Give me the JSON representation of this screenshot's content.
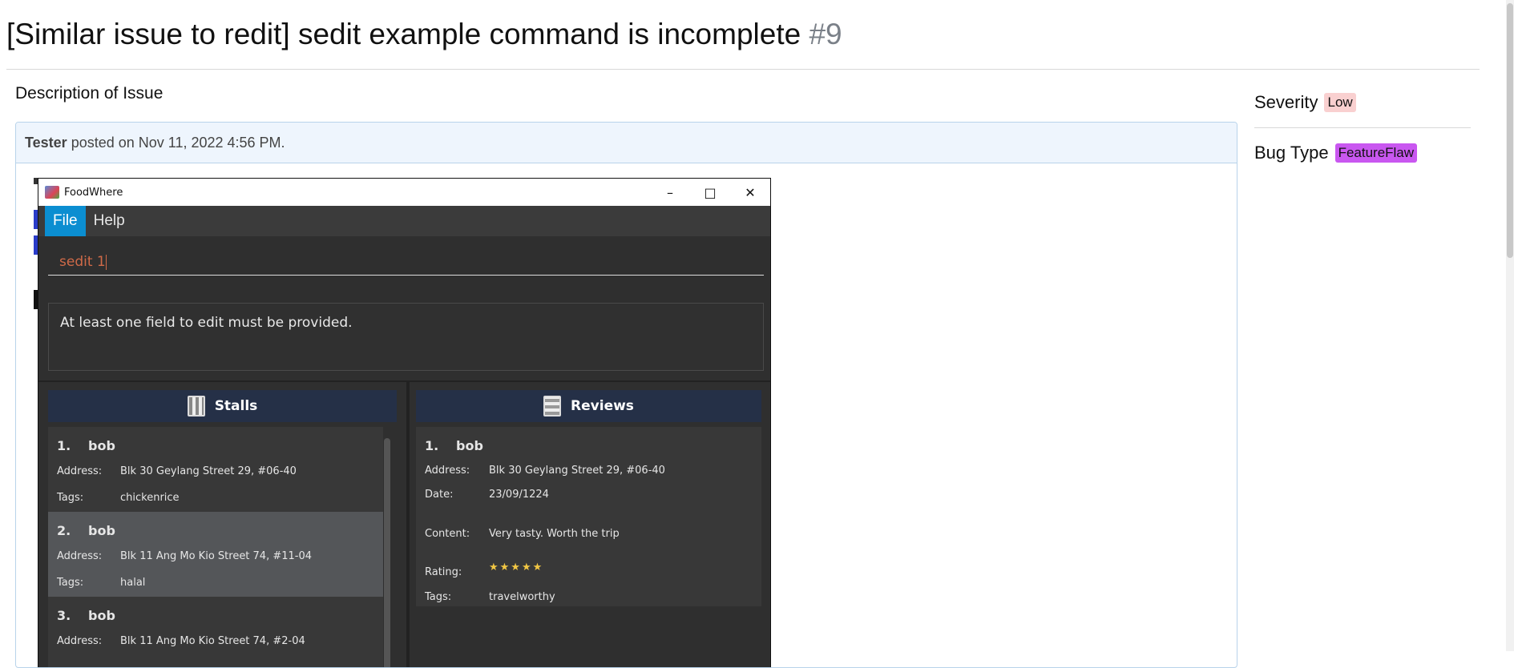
{
  "issue": {
    "title": "[Similar issue to redit] sedit example command is incomplete",
    "number": "#9"
  },
  "description": {
    "heading": "Description of Issue"
  },
  "comment": {
    "author": "Tester",
    "meta": " posted on Nov 11, 2022 4:56 PM."
  },
  "sidebar": {
    "severity_label": "Severity",
    "severity_value": "Low",
    "bugtype_label": "Bug Type",
    "bugtype_value": "FeatureFlaw"
  },
  "app": {
    "window_title": "FoodWhere",
    "menus": [
      "File",
      "Help"
    ],
    "command_text": "sedit 1",
    "result_text": "At least one field to edit must be provided.",
    "stalls_header": "Stalls",
    "reviews_header": "Reviews",
    "stalls": [
      {
        "num": "1.",
        "name": "bob",
        "address_key": "Address:",
        "address": "Blk 30 Geylang Street 29, #06-40",
        "tags_key": "Tags:",
        "tags": "chickenrice"
      },
      {
        "num": "2.",
        "name": "bob",
        "address_key": "Address:",
        "address": "Blk 11 Ang Mo Kio Street 74, #11-04",
        "tags_key": "Tags:",
        "tags": "halal"
      },
      {
        "num": "3.",
        "name": "bob",
        "address_key": "Address:",
        "address": "Blk 11 Ang Mo Kio Street 74, #2-04"
      }
    ],
    "review": {
      "num": "1.",
      "name": "bob",
      "address_key": "Address:",
      "address": "Blk 30 Geylang Street 29, #06-40",
      "date_key": "Date:",
      "date": "23/09/1224",
      "content_key": "Content:",
      "content": "Very tasty. Worth the trip",
      "rating_key": "Rating:",
      "rating": 5,
      "rating_stars": "★★★★★",
      "tags_key": "Tags:",
      "tags": "travelworthy"
    }
  }
}
